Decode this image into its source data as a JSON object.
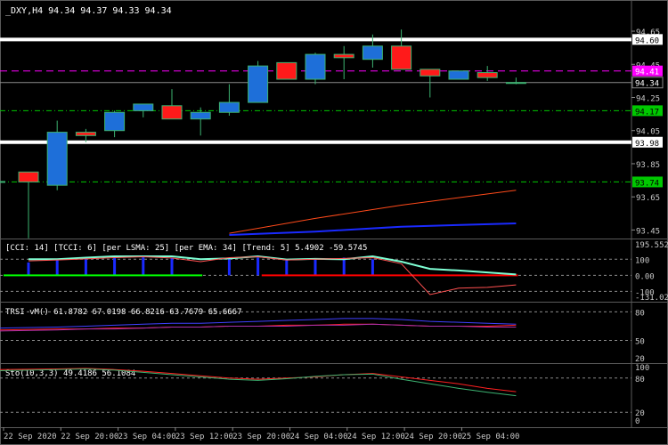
{
  "chart_data": [
    {
      "type": "candlestick",
      "title": "_DXY,H4  94.34 94.37 94.33 94.34",
      "x_tick_labels": [
        "22 Sep 2020",
        "22 Sep 20:00",
        "23 Sep 04:00",
        "23 Sep 12:00",
        "23 Sep 20:00",
        "24 Sep 04:00",
        "24 Sep 12:00",
        "24 Sep 20:00",
        "25 Sep 04:00"
      ],
      "ylim": [
        93.42,
        94.72
      ],
      "y_ticks": [
        "94.65",
        "94.45",
        "94.25",
        "94.05",
        "93.85",
        "93.65",
        "93.45"
      ],
      "candles": [
        {
          "o": 93.8,
          "h": 93.8,
          "l": 93.4,
          "c": 93.74
        },
        {
          "o": 93.72,
          "h": 94.11,
          "l": 93.69,
          "c": 94.04
        },
        {
          "o": 94.04,
          "h": 94.06,
          "l": 93.98,
          "c": 94.02
        },
        {
          "o": 94.05,
          "h": 94.17,
          "l": 94.01,
          "c": 94.16
        },
        {
          "o": 94.17,
          "h": 94.21,
          "l": 94.13,
          "c": 94.21
        },
        {
          "o": 94.2,
          "h": 94.3,
          "l": 94.12,
          "c": 94.12
        },
        {
          "o": 94.12,
          "h": 94.19,
          "l": 94.02,
          "c": 94.16
        },
        {
          "o": 94.16,
          "h": 94.33,
          "l": 94.14,
          "c": 94.22
        },
        {
          "o": 94.22,
          "h": 94.47,
          "l": 94.22,
          "c": 94.44
        },
        {
          "o": 94.46,
          "h": 94.46,
          "l": 94.36,
          "c": 94.36
        },
        {
          "o": 94.36,
          "h": 94.52,
          "l": 94.33,
          "c": 94.51
        },
        {
          "o": 94.51,
          "h": 94.56,
          "l": 94.36,
          "c": 94.49
        },
        {
          "o": 94.48,
          "h": 94.63,
          "l": 94.43,
          "c": 94.56
        },
        {
          "o": 94.56,
          "h": 94.66,
          "l": 94.42,
          "c": 94.42
        },
        {
          "o": 94.42,
          "h": 94.42,
          "l": 94.25,
          "c": 94.38
        },
        {
          "o": 94.36,
          "h": 94.41,
          "l": 94.36,
          "c": 94.41
        },
        {
          "o": 94.4,
          "h": 94.44,
          "l": 94.35,
          "c": 94.37
        },
        {
          "o": 94.34,
          "h": 94.37,
          "l": 94.33,
          "c": 94.34
        }
      ],
      "horizontal_levels": [
        {
          "value": 94.6,
          "label": "94.60",
          "style": "solid-thick",
          "color": "#ffffff"
        },
        {
          "value": 94.41,
          "label": "94.41",
          "style": "dashed",
          "color": "#ff00ff"
        },
        {
          "value": 94.34,
          "label": "94.34",
          "style": "solid-thin",
          "color": "#8a8a8a"
        },
        {
          "value": 94.17,
          "label": "94.17",
          "style": "dash-dot",
          "color": "#00c800"
        },
        {
          "value": 93.98,
          "label": "93.98",
          "style": "solid-thick",
          "color": "#ffffff"
        },
        {
          "value": 93.74,
          "label": "93.74",
          "style": "dash-dot",
          "color": "#00c800"
        }
      ],
      "moving_averages": [
        {
          "color": "#ff4a1a",
          "points": [
            [
              7,
              93.43
            ],
            [
              10,
              93.52
            ],
            [
              13,
              93.6
            ],
            [
              17,
              93.69
            ]
          ]
        },
        {
          "color": "#1a2aff",
          "points": [
            [
              7,
              93.42
            ],
            [
              10,
              93.44
            ],
            [
              13,
              93.47
            ],
            [
              17,
              93.49
            ]
          ]
        }
      ]
    },
    {
      "type": "line",
      "title": "[CCI: 14] [TCCI: 6] [per LSMA: 25] [per EMA: 34] [Trend: 5]  5.4902 -59.5745",
      "ylim": [
        -131.026,
        195.5526
      ],
      "y_ticks": [
        "195.5526",
        "100",
        "0.00",
        "-100",
        "-131.026"
      ],
      "series": [
        {
          "color": "#7fffd4",
          "values": [
            100,
            100,
            110,
            118,
            118,
            118,
            100,
            105,
            118,
            98,
            102,
            100,
            118,
            85,
            40,
            30,
            18,
            5
          ]
        },
        {
          "color": "#ff5050",
          "values": [
            90,
            95,
            102,
            110,
            115,
            108,
            85,
            110,
            115,
            95,
            100,
            105,
            110,
            72,
            -120,
            -80,
            -75,
            -60
          ]
        }
      ],
      "histogram": [
        80,
        95,
        100,
        108,
        112,
        108,
        0,
        110,
        110,
        100,
        100,
        110,
        100,
        0,
        0,
        0,
        0,
        0
      ],
      "trend_segments": [
        {
          "from": 0,
          "to": 6,
          "value": 0,
          "color": "#00ff00"
        },
        {
          "from": 9,
          "to": 17,
          "value": 0,
          "color": "#ff0000"
        }
      ]
    },
    {
      "type": "line",
      "title": "TRSI vM() 61.8782 67.0198 66.8216 63.7679 65.6667",
      "ylim": [
        30,
        85
      ],
      "y_ticks": [
        "80",
        "50",
        "20"
      ],
      "series": [
        {
          "color": "#4040ff",
          "values": [
            63,
            64,
            65,
            66,
            67,
            68,
            68,
            69,
            70,
            71,
            72,
            73,
            73,
            72,
            70,
            69,
            68,
            67
          ]
        },
        {
          "color": "#ff2020",
          "values": [
            61,
            62,
            62,
            63,
            63,
            64,
            64,
            65,
            65,
            66,
            66,
            67,
            67,
            66,
            65,
            65,
            65,
            66
          ]
        },
        {
          "color": "#aa30aa",
          "values": [
            60,
            61,
            62,
            62,
            63,
            64,
            64,
            65,
            65,
            65,
            66,
            66,
            67,
            66,
            65,
            65,
            64,
            64
          ]
        }
      ]
    },
    {
      "type": "line",
      "title": "Sto(10,3,3) 49.4186 56.1084",
      "ylim": [
        0,
        100
      ],
      "y_ticks": [
        "100",
        "80",
        "20",
        "0"
      ],
      "series": [
        {
          "color": "#ff2020",
          "values": [
            95,
            96,
            97,
            95,
            92,
            88,
            84,
            80,
            78,
            80,
            82,
            86,
            88,
            82,
            76,
            70,
            62,
            56
          ]
        },
        {
          "color": "#3cb371",
          "values": [
            93,
            95,
            96,
            94,
            90,
            86,
            82,
            78,
            76,
            79,
            83,
            86,
            87,
            78,
            70,
            62,
            55,
            49
          ]
        }
      ]
    }
  ]
}
